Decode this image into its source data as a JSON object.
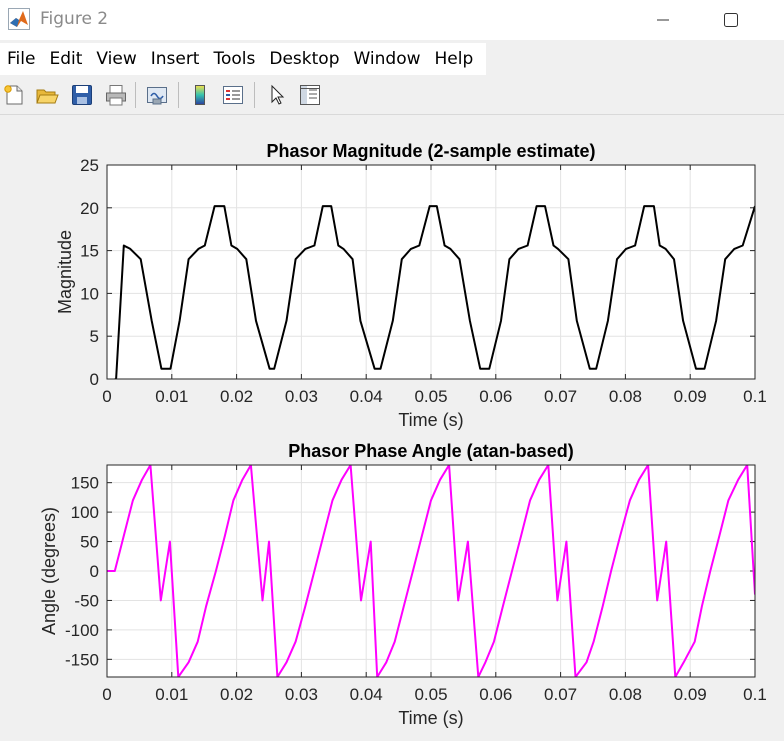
{
  "window": {
    "title": "Figure 2",
    "icon": "matlab-icon",
    "controls": [
      "minimize-icon",
      "maximize-icon"
    ]
  },
  "menu": [
    "File",
    "Edit",
    "View",
    "Insert",
    "Tools",
    "Desktop",
    "Window",
    "Help"
  ],
  "toolbar": {
    "buttons": [
      "new-figure-icon",
      "open-file-icon",
      "save-icon",
      "print-icon",
      "link-plot-icon",
      "insert-colorbar-icon",
      "insert-legend-icon",
      "edit-plot-pointer-icon",
      "property-inspector-icon"
    ]
  },
  "chart_data": [
    {
      "type": "line",
      "title": "Phasor Magnitude (2-sample estimate)",
      "xlabel": "Time (s)",
      "ylabel": "Magnitude",
      "xlim": [
        0,
        0.1
      ],
      "ylim": [
        0,
        25
      ],
      "xticks": [
        "0",
        "0.01",
        "0.02",
        "0.03",
        "0.04",
        "0.05",
        "0.06",
        "0.07",
        "0.08",
        "0.09",
        "0.1"
      ],
      "yticks": [
        "0",
        "5",
        "10",
        "15",
        "20",
        "25"
      ],
      "grid": true,
      "series": [
        {
          "color": "#000000",
          "x": [
            0.0012,
            0.0014,
            0.0026,
            0.0036,
            0.0052,
            0.0069,
            0.0084,
            0.0098,
            0.0112,
            0.0126,
            0.0141,
            0.0151,
            0.0166,
            0.0181,
            0.0192,
            0.0201,
            0.0215,
            0.023,
            0.0251,
            0.0258,
            0.0277,
            0.0291,
            0.0306,
            0.032,
            0.0333,
            0.0346,
            0.0357,
            0.0365,
            0.0379,
            0.0391,
            0.0413,
            0.0422,
            0.0441,
            0.0455,
            0.0469,
            0.0482,
            0.0498,
            0.0509,
            0.0521,
            0.053,
            0.0544,
            0.056,
            0.0576,
            0.059,
            0.0608,
            0.0621,
            0.0635,
            0.0649,
            0.0663,
            0.0676,
            0.0689,
            0.0696,
            0.0712,
            0.0725,
            0.0745,
            0.0755,
            0.0773,
            0.0787,
            0.0801,
            0.0815,
            0.0829,
            0.0844,
            0.0853,
            0.0862,
            0.0875,
            0.0889,
            0.0909,
            0.0922,
            0.094,
            0.0954,
            0.0968,
            0.0981,
            0.1
          ],
          "y": [
            0,
            0,
            15.6,
            15.2,
            14,
            6.8,
            1.2,
            1.2,
            6.8,
            14,
            15.2,
            15.6,
            20.2,
            20.2,
            15.6,
            15.2,
            14,
            6.8,
            1.2,
            1.2,
            6.8,
            14,
            15.2,
            15.6,
            20.2,
            20.2,
            15.6,
            15.2,
            14,
            6.8,
            1.2,
            1.2,
            6.8,
            14,
            15.2,
            15.6,
            20.2,
            20.2,
            15.6,
            15.2,
            14,
            6.8,
            1.2,
            1.2,
            6.8,
            14,
            15.2,
            15.6,
            20.2,
            20.2,
            15.6,
            15.2,
            14,
            6.8,
            1.2,
            1.2,
            6.8,
            14,
            15.2,
            15.6,
            20.2,
            20.2,
            15.6,
            15.2,
            14,
            6.8,
            1.2,
            1.2,
            6.8,
            14,
            15.2,
            15.6,
            20.2
          ]
        }
      ]
    },
    {
      "type": "line",
      "title": "Phasor Phase Angle (atan-based)",
      "xlabel": "Time (s)",
      "ylabel": "Angle (degrees)",
      "xlim": [
        0,
        0.1
      ],
      "ylim": [
        -180,
        180
      ],
      "xticks": [
        "0",
        "0.01",
        "0.02",
        "0.03",
        "0.04",
        "0.05",
        "0.06",
        "0.07",
        "0.08",
        "0.09",
        "0.1"
      ],
      "yticks": [
        "-150",
        "-100",
        "-50",
        "0",
        "50",
        "100",
        "150"
      ],
      "grid": true,
      "series": [
        {
          "color": "#ff00ff",
          "x": [
            0,
            0.0012,
            0.0026,
            0.004,
            0.0054,
            0.0067,
            0.0083,
            0.0097,
            0.011,
            0.0126,
            0.014,
            0.0153,
            0.0168,
            0.0182,
            0.0195,
            0.0209,
            0.0222,
            0.024,
            0.025,
            0.0263,
            0.0277,
            0.0291,
            0.0306,
            0.032,
            0.0334,
            0.0348,
            0.0362,
            0.0376,
            0.0392,
            0.0407,
            0.0417,
            0.0431,
            0.0444,
            0.0458,
            0.0472,
            0.0486,
            0.05,
            0.0514,
            0.0528,
            0.0542,
            0.0557,
            0.0573,
            0.0584,
            0.0597,
            0.0611,
            0.0625,
            0.0639,
            0.0653,
            0.0667,
            0.0681,
            0.0695,
            0.0709,
            0.0723,
            0.074,
            0.0751,
            0.0765,
            0.0778,
            0.0792,
            0.0807,
            0.0821,
            0.0835,
            0.0849,
            0.0863,
            0.0877,
            0.089,
            0.0907,
            0.0918,
            0.0931,
            0.0945,
            0.0959,
            0.0974,
            0.0988,
            0.1
          ],
          "y": [
            0,
            0,
            60,
            120,
            155,
            180,
            -50,
            50,
            -180,
            -155,
            -120,
            -60,
            0,
            60,
            120,
            155,
            180,
            -50,
            50,
            -180,
            -155,
            -120,
            -60,
            0,
            60,
            120,
            155,
            180,
            -50,
            50,
            -180,
            -155,
            -120,
            -60,
            0,
            60,
            120,
            155,
            180,
            -50,
            50,
            -180,
            -155,
            -120,
            -60,
            0,
            60,
            120,
            155,
            180,
            -50,
            50,
            -180,
            -155,
            -120,
            -60,
            0,
            60,
            120,
            155,
            180,
            -50,
            50,
            -180,
            -155,
            -120,
            -60,
            0,
            60,
            120,
            155,
            180,
            -40
          ]
        }
      ]
    }
  ]
}
